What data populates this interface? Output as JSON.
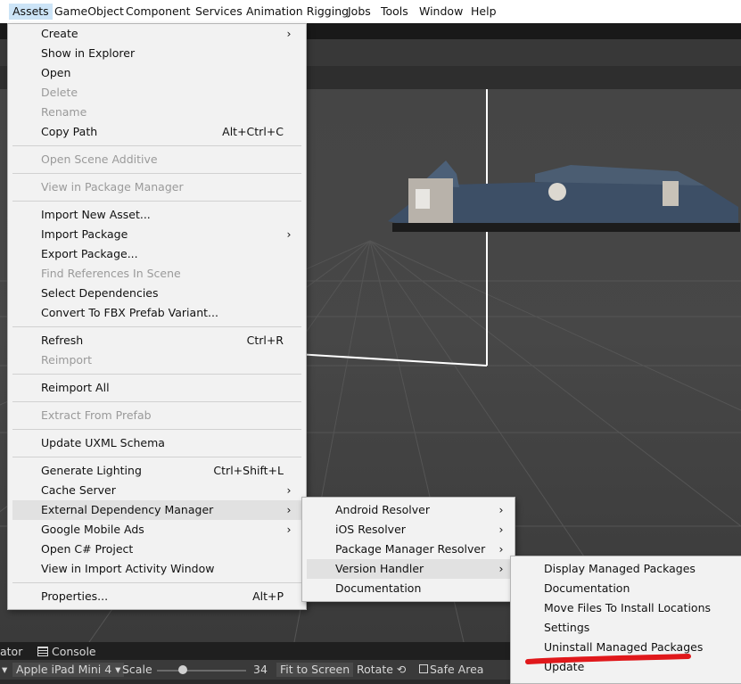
{
  "menubar": {
    "items": [
      "Assets",
      "GameObject",
      "Component",
      "Services",
      "Animation Rigging",
      "Jobs",
      "Tools",
      "Window",
      "Help"
    ]
  },
  "assets_menu": {
    "items": [
      {
        "label": "Create",
        "arrow": "›"
      },
      {
        "label": "Show in Explorer"
      },
      {
        "label": "Open"
      },
      {
        "label": "Delete",
        "disabled": true
      },
      {
        "label": "Rename",
        "disabled": true
      },
      {
        "label": "Copy Path",
        "shortcut": "Alt+Ctrl+C"
      },
      {
        "label": "Open Scene Additive",
        "disabled": true
      },
      {
        "label": "View in Package Manager",
        "disabled": true
      },
      {
        "label": "Import New Asset..."
      },
      {
        "label": "Import Package",
        "arrow": "›"
      },
      {
        "label": "Export Package..."
      },
      {
        "label": "Find References In Scene",
        "disabled": true
      },
      {
        "label": "Select Dependencies"
      },
      {
        "label": "Convert To FBX Prefab Variant..."
      },
      {
        "label": "Refresh",
        "shortcut": "Ctrl+R"
      },
      {
        "label": "Reimport",
        "disabled": true
      },
      {
        "label": "Reimport All"
      },
      {
        "label": "Extract From Prefab",
        "disabled": true
      },
      {
        "label": "Update UXML Schema"
      },
      {
        "label": "Generate Lighting",
        "shortcut": "Ctrl+Shift+L"
      },
      {
        "label": "Cache Server",
        "arrow": "›"
      },
      {
        "label": "External Dependency Manager",
        "arrow": "›",
        "highlighted": true
      },
      {
        "label": "Google Mobile Ads",
        "arrow": "›"
      },
      {
        "label": "Open C# Project"
      },
      {
        "label": "View in Import Activity Window"
      },
      {
        "label": "Properties...",
        "shortcut": "Alt+P"
      }
    ]
  },
  "edm_menu": {
    "items": [
      {
        "label": "Android Resolver",
        "arrow": "›"
      },
      {
        "label": "iOS Resolver",
        "arrow": "›"
      },
      {
        "label": "Package Manager Resolver",
        "arrow": "›"
      },
      {
        "label": "Version Handler",
        "arrow": "›",
        "highlighted": true
      },
      {
        "label": "Documentation"
      }
    ]
  },
  "version_menu": {
    "items": [
      {
        "label": "Display Managed Packages"
      },
      {
        "label": "Documentation"
      },
      {
        "label": "Move Files To Install Locations"
      },
      {
        "label": "Settings"
      },
      {
        "label": "Uninstall Managed Packages"
      },
      {
        "label": "Update"
      }
    ]
  },
  "bottom_tabs": {
    "animator_partial": "ator",
    "console": "Console"
  },
  "game_toolbar": {
    "device": "Apple iPad Mini 4",
    "scale_label": "Scale",
    "scale_value": "34",
    "fit": "Fit to Screen",
    "rotate": "Rotate",
    "safe_area": "Safe Area"
  },
  "colors": {
    "annotation": "#e0181b",
    "menu_bg": "#f2f2f2",
    "highlight": "#e1e1e1"
  }
}
